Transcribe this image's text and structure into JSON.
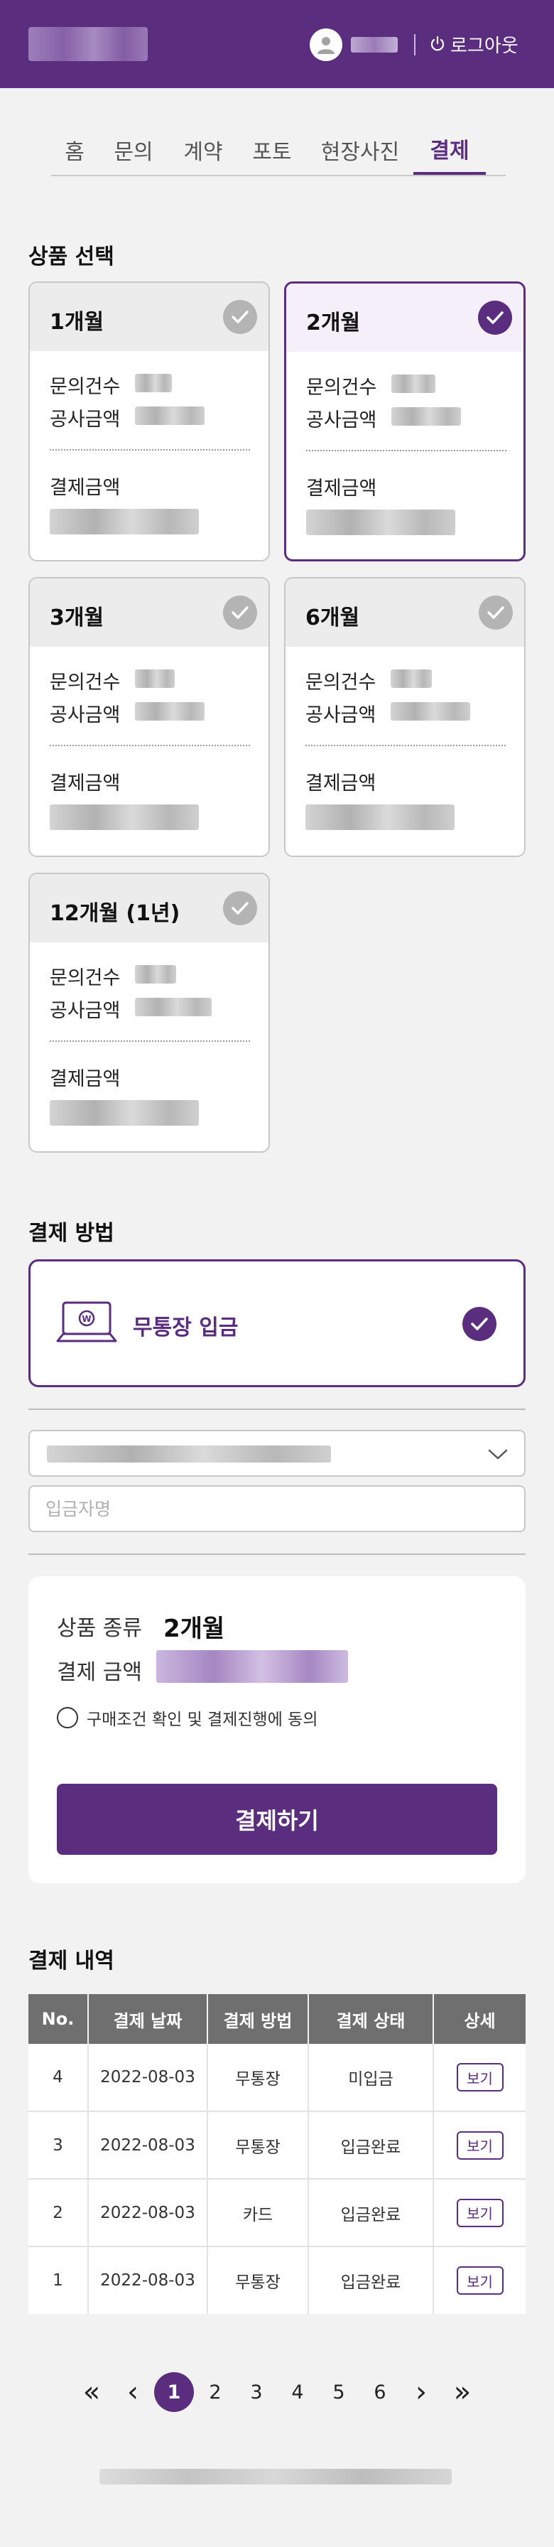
{
  "header": {
    "logout_label": "로그아웃"
  },
  "tabs": [
    {
      "label": "홈"
    },
    {
      "label": "문의"
    },
    {
      "label": "계약"
    },
    {
      "label": "포토"
    },
    {
      "label": "현장사진"
    },
    {
      "label": "결제"
    }
  ],
  "active_tab": "결제",
  "product_section": {
    "title": "상품 선택",
    "inquiry_label": "문의건수",
    "construction_label": "공사금액",
    "payment_label": "결제금액",
    "products": [
      {
        "name": "1개월",
        "selected": false
      },
      {
        "name": "2개월",
        "selected": true
      },
      {
        "name": "3개월",
        "selected": false
      },
      {
        "name": "6개월",
        "selected": false
      },
      {
        "name": "12개월 (1년)",
        "selected": false
      }
    ]
  },
  "payment_method": {
    "title": "결제 방법",
    "label": "무통장 입금",
    "depositor_placeholder": "입금자명"
  },
  "summary": {
    "product_type_label": "상품 종류",
    "product_type_value": "2개월",
    "amount_label": "결제 금액",
    "agree_label": "구매조건 확인 및 결제진행에 동의",
    "pay_button": "결제하기"
  },
  "history": {
    "title": "결제 내역",
    "columns": [
      "No.",
      "결제 날짜",
      "결제 방법",
      "결제 상태",
      "상세"
    ],
    "view_label": "보기",
    "rows": [
      {
        "no": "4",
        "date": "2022-08-03",
        "method": "무통장",
        "status": "미입금"
      },
      {
        "no": "3",
        "date": "2022-08-03",
        "method": "무통장",
        "status": "입금완료"
      },
      {
        "no": "2",
        "date": "2022-08-03",
        "method": "카드",
        "status": "입금완료"
      },
      {
        "no": "1",
        "date": "2022-08-03",
        "method": "무통장",
        "status": "입금완료"
      }
    ]
  },
  "pagination": {
    "first": "«",
    "prev": "‹",
    "next": "›",
    "last": "»",
    "pages": [
      "1",
      "2",
      "3",
      "4",
      "5",
      "6"
    ],
    "current": "1"
  },
  "colors": {
    "brand": "#5b2d7e",
    "table_header": "#6f6f6f",
    "background": "#f2f2f2"
  },
  "icons": [
    "user-icon",
    "power-icon",
    "check-icon",
    "laptop-won-icon",
    "chevron-down-icon"
  ]
}
